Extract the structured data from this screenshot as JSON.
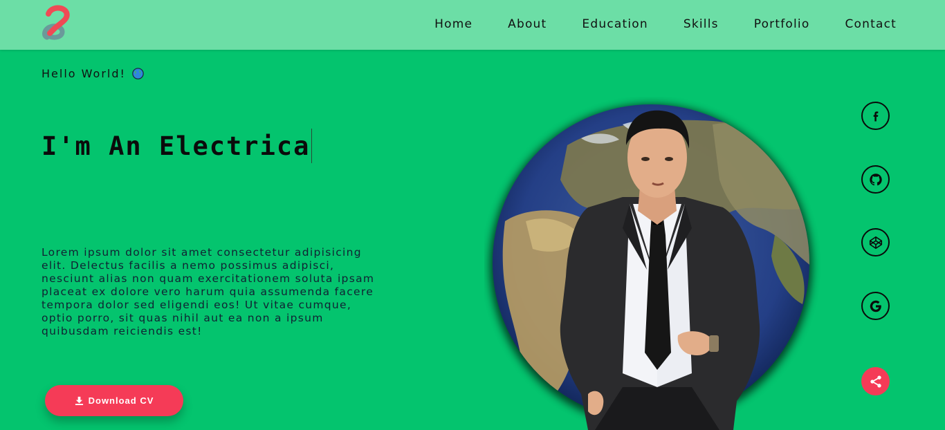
{
  "header": {
    "logo_icon": "dual-s-logo-icon",
    "nav": [
      {
        "label": "Home"
      },
      {
        "label": "About"
      },
      {
        "label": "Education"
      },
      {
        "label": "Skills"
      },
      {
        "label": "Portfolio"
      },
      {
        "label": "Contact"
      }
    ]
  },
  "hero": {
    "greeting": "Hello World!",
    "greeting_icon": "globe-icon",
    "typed_text": "I'm An Electrica",
    "description": "Lorem ipsum dolor sit amet consectetur adipisicing elit. Delectus facilis a nemo possimus adipisci, nesciunt alias non quam exercitationem soluta ipsam placeat ex dolore vero harum quia assumenda facere tempora dolor sed eligendi eos! Ut vitae cumque, optio porro, sit quas nihil aut ea non a ipsum quibusdam reiciendis est!",
    "download_label": "Download CV",
    "download_icon": "download-icon"
  },
  "photo": {
    "subject": "man-in-suit-with-world-globe-background"
  },
  "social": [
    {
      "icon": "facebook-icon"
    },
    {
      "icon": "github-icon"
    },
    {
      "icon": "codepen-icon"
    },
    {
      "icon": "google-icon"
    }
  ],
  "share": {
    "icon": "share-icon"
  },
  "colors": {
    "background": "#04c46e",
    "header": "#6cdea6",
    "accent": "#f53b57",
    "text": "#111111"
  }
}
